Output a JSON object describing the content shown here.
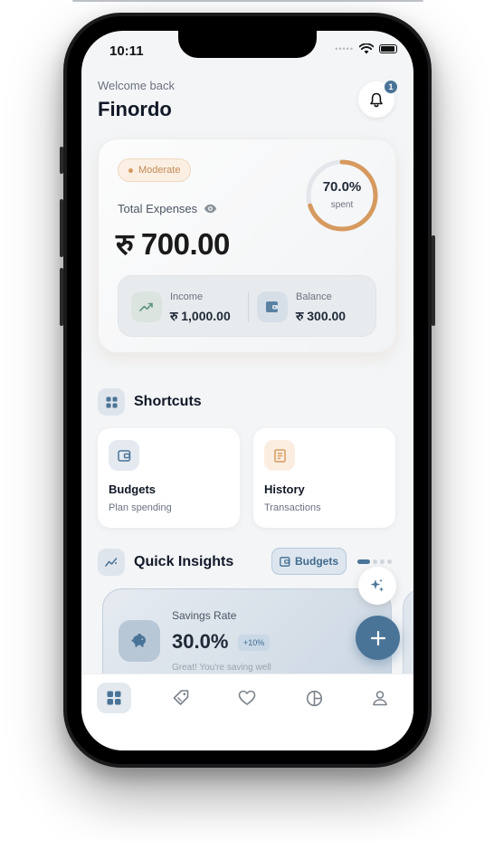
{
  "status_bar": {
    "time": "10:11",
    "signal": "•••••"
  },
  "header": {
    "greeting": "Welcome back",
    "app_name": "Finordo",
    "notification_count": "1"
  },
  "summary": {
    "status_pill": "Moderate",
    "total_label": "Total Expenses",
    "total_amount": "रु 700.00",
    "spent_percent": "70.0%",
    "spent_fraction": 0.7,
    "spent_label": "spent",
    "income_label": "Income",
    "income_value": "रु 1,000.00",
    "balance_label": "Balance",
    "balance_value": "रु 300.00"
  },
  "shortcuts": {
    "title": "Shortcuts",
    "items": [
      {
        "title": "Budgets",
        "subtitle": "Plan spending",
        "icon": "wallet-icon"
      },
      {
        "title": "History",
        "subtitle": "Transactions",
        "icon": "receipt-icon"
      }
    ]
  },
  "insights": {
    "title": "Quick Insights",
    "budgets_button": "Budgets",
    "card": {
      "label": "Savings Rate",
      "value": "30.0%",
      "badge": "+10%",
      "description": "Great! You're saving well",
      "icon": "piggy-bank-icon"
    }
  },
  "colors": {
    "accent": "#4a7497",
    "warning": "#d69a5f",
    "background": "#f3f5f7"
  },
  "tabs": [
    {
      "name": "dashboard",
      "icon": "grid-icon",
      "active": true
    },
    {
      "name": "transactions",
      "icon": "tag-icon",
      "active": false
    },
    {
      "name": "favorites",
      "icon": "heart-icon",
      "active": false
    },
    {
      "name": "reports",
      "icon": "pie-chart-icon",
      "active": false
    },
    {
      "name": "profile",
      "icon": "user-icon",
      "active": false
    }
  ]
}
